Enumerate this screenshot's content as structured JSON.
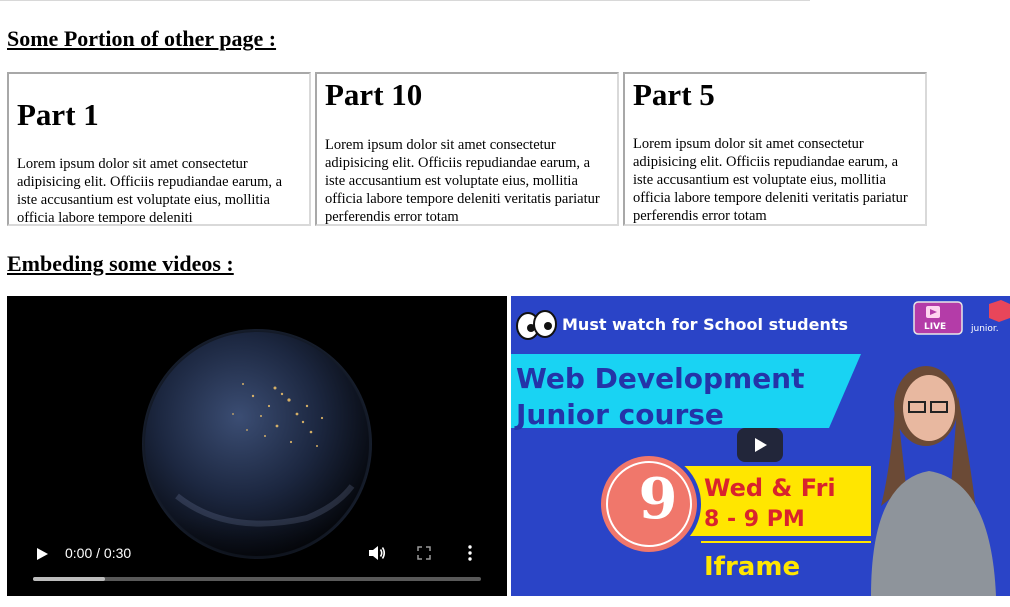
{
  "headings": {
    "portion": "Some Portion of other page :",
    "videos": "Embeding some videos :"
  },
  "frames": [
    {
      "title": "Part 1",
      "text": "Lorem ipsum dolor sit amet consectetur adipisicing elit. Officiis repudiandae earum, a iste accusantium est voluptate eius, mollitia officia labore tempore deleniti"
    },
    {
      "title": "Part 10",
      "text": "Lorem ipsum dolor sit amet consectetur adipisicing elit. Officiis repudiandae earum, a iste accusantium est voluptate eius, mollitia officia labore tempore deleniti veritatis pariatur perferendis error totam"
    },
    {
      "title": "Part 5",
      "text": "Lorem ipsum dolor sit amet consectetur adipisicing elit. Officiis repudiandae earum, a iste accusantium est voluptate eius, mollitia officia labore tempore deleniti veritatis pariatur perferendis error totam"
    }
  ],
  "video": {
    "time": "0:00 / 0:30",
    "buffered_fraction": 0.16,
    "icons": [
      "play-icon",
      "volume-icon",
      "fullscreen-icon",
      "more-vertical-icon"
    ]
  },
  "youtube": {
    "tagline": "Must watch for School students",
    "title_line1": "Web Development",
    "title_line2": "Junior course",
    "number": "9",
    "days": "Wed & Fri",
    "time": "8 - 9 PM",
    "topic": "Iframe",
    "live_badge": "LIVE",
    "brand": "junior."
  },
  "colors": {
    "youtube_bg": "#2a44c7",
    "cyan_banner": "#19d3f3",
    "yellow_banner": "#ffe600",
    "accent_red": "#d9232d"
  }
}
